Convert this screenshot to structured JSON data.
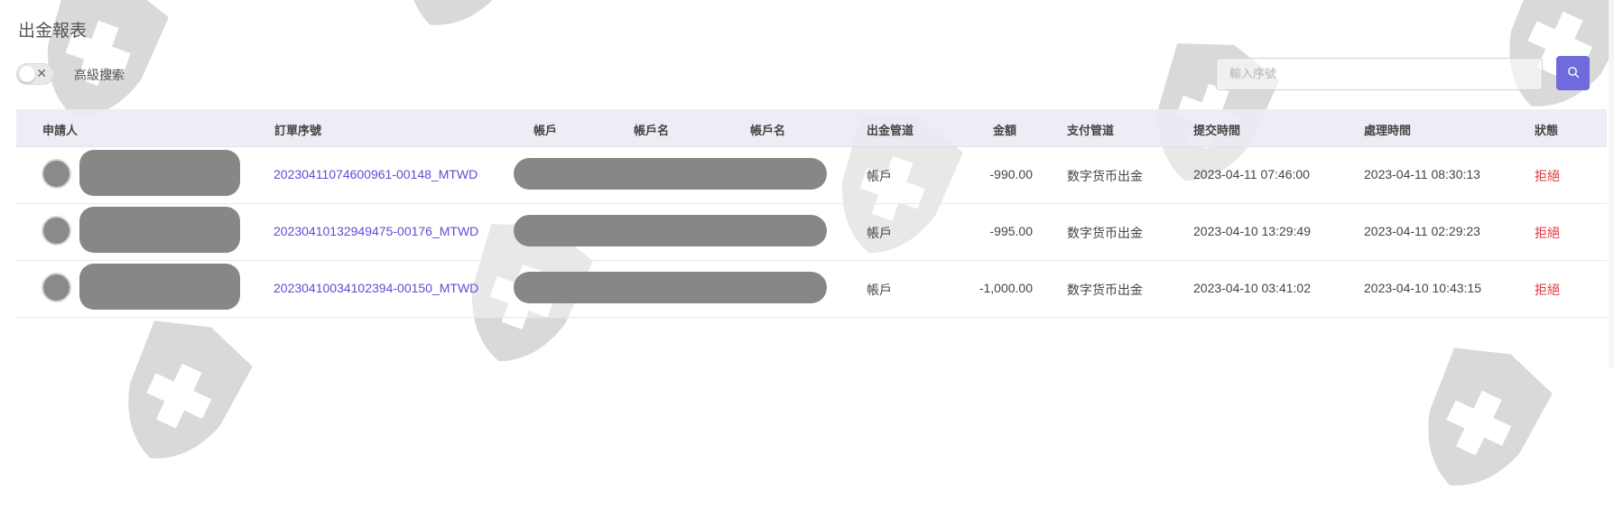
{
  "page": {
    "title": "出金報表"
  },
  "filters": {
    "advanced_search_label": "高級搜索",
    "toggle_off_glyph": "✕"
  },
  "search": {
    "placeholder": "輸入序號",
    "button_icon": "search-icon"
  },
  "table": {
    "headers": {
      "applicant": "申請人",
      "order_no": "訂單序號",
      "account": "帳戶",
      "account_name_1": "帳戶名",
      "account_name_2": "帳戶名",
      "withdraw_channel": "出金管道",
      "amount": "金額",
      "payment_channel": "支付管道",
      "submit_time": "提交時間",
      "process_time": "處理時間",
      "status": "狀態"
    },
    "rows": [
      {
        "order_no": "20230411074600961-00148_MTWD",
        "withdraw_channel": "帳戶",
        "amount": "-990.00",
        "payment_channel": "数字货币出金",
        "submit_time": "2023-04-11 07:46:00",
        "process_time": "2023-04-11 08:30:13",
        "status": "拒絕"
      },
      {
        "order_no": "20230410132949475-00176_MTWD",
        "withdraw_channel": "帳戶",
        "amount": "-995.00",
        "payment_channel": "数字货币出金",
        "submit_time": "2023-04-10 13:29:49",
        "process_time": "2023-04-11 02:29:23",
        "status": "拒絕"
      },
      {
        "order_no": "20230410034102394-00150_MTWD",
        "withdraw_channel": "帳戶",
        "amount": "-1,000.00",
        "payment_channel": "数字货币出金",
        "submit_time": "2023-04-10 03:41:02",
        "process_time": "2023-04-10 10:43:15",
        "status": "拒絕"
      }
    ]
  },
  "colors": {
    "accent": "#6f6bdc",
    "link": "#5a4fd6",
    "status_rejected": "#e0383e",
    "header_bg": "#ececf4",
    "redaction": "#878787"
  }
}
